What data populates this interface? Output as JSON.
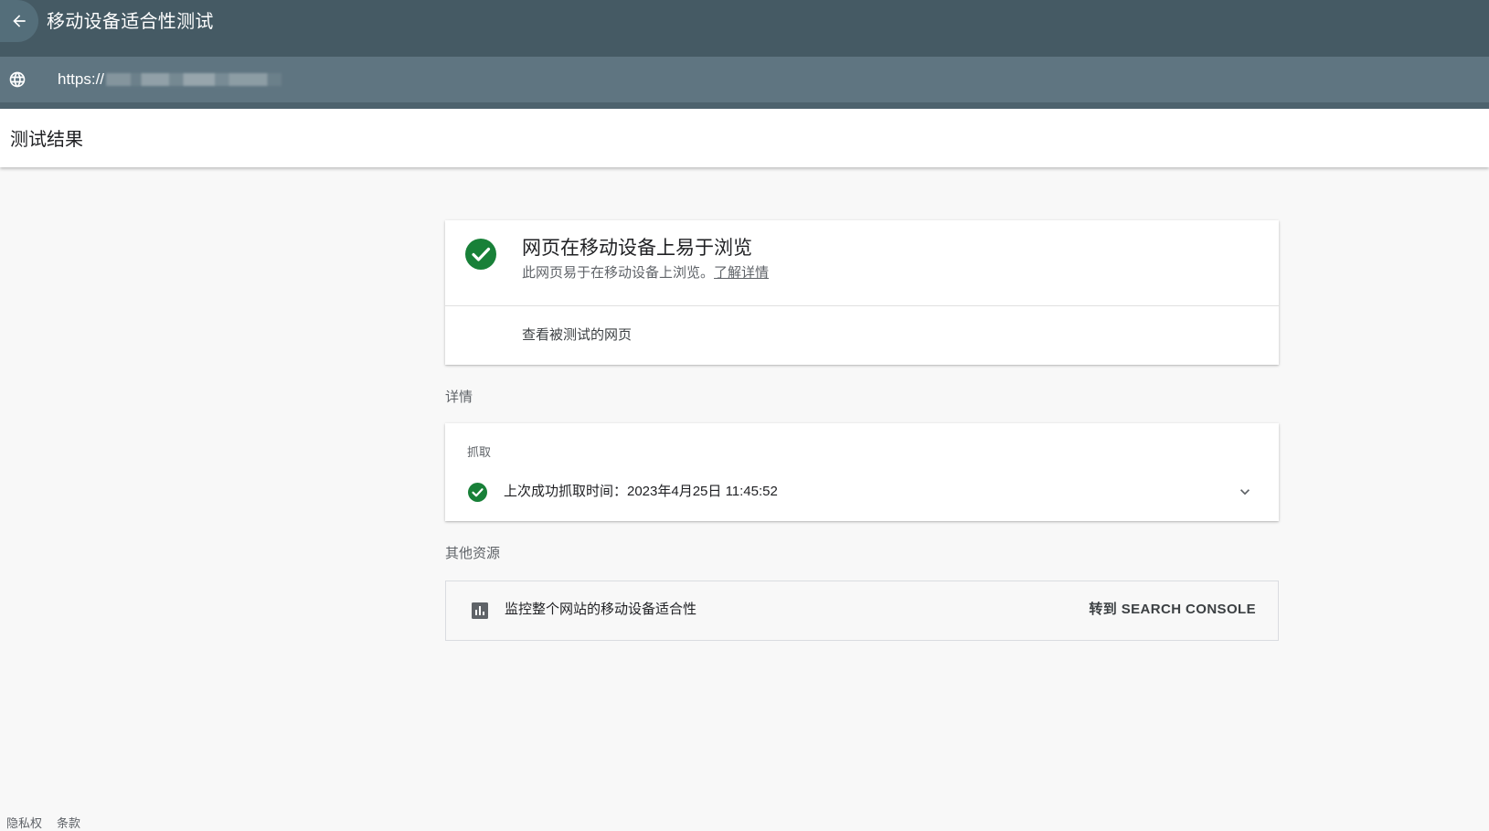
{
  "header": {
    "title": "移动设备适合性测试",
    "url_prefix": "https://"
  },
  "results_bar": {
    "title": "测试结果"
  },
  "summary_card": {
    "heading": "网页在移动设备上易于浏览",
    "description": "此网页易于在移动设备上浏览。",
    "learn_more": "了解详情",
    "view_tested_page": "查看被测试的网页",
    "status_color": "#188038"
  },
  "details": {
    "section_label": "详情",
    "crawl": {
      "label": "抓取",
      "status_text": "上次成功抓取时间：2023年4月25日 11:45:52"
    }
  },
  "other_resources": {
    "section_label": "其他资源",
    "monitor_text": "监控整个网站的移动设备适合性",
    "search_console_link": "转到 SEARCH CONSOLE"
  },
  "footer": {
    "privacy": "隐私权",
    "terms": "条款"
  },
  "icons": {
    "back": "arrow-left-icon",
    "globe": "globe-icon",
    "check": "check-circle-icon",
    "expand": "chevron-down-icon",
    "chart": "bar-chart-icon"
  }
}
